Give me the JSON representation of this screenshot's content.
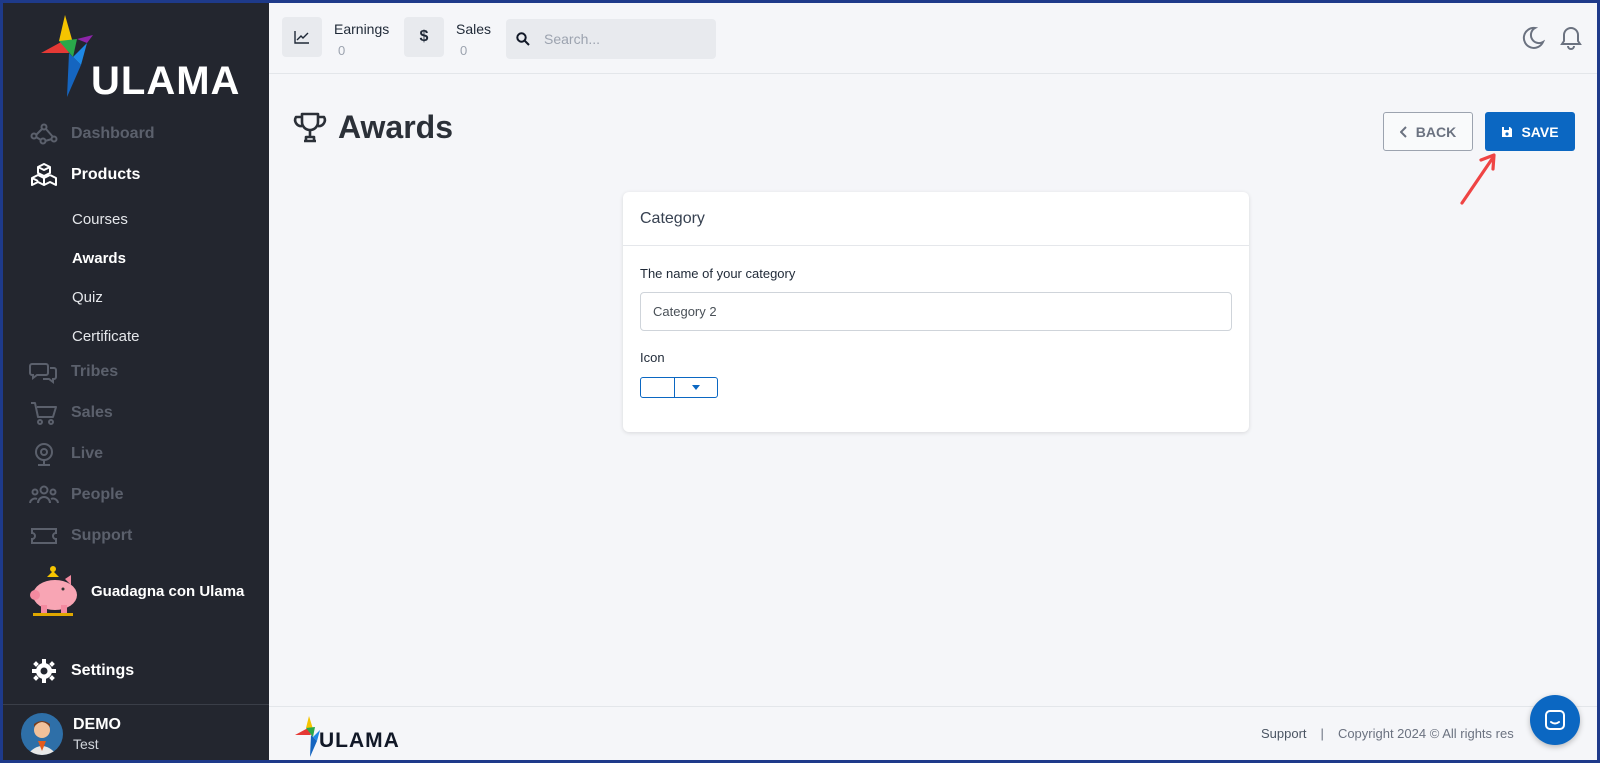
{
  "brand": {
    "name": "ULAMA"
  },
  "sidebar": {
    "items": {
      "dashboard": "Dashboard",
      "products": "Products",
      "tribes": "Tribes",
      "sales": "Sales",
      "live": "Live",
      "people": "People",
      "support": "Support",
      "settings": "Settings"
    },
    "product_sub": [
      "Courses",
      "Awards",
      "Quiz",
      "Certificate"
    ],
    "promo_label": "Guadagna con Ulama",
    "user": {
      "name": "DEMO",
      "role": "Test"
    }
  },
  "topbar": {
    "earnings": {
      "title": "Earnings",
      "value": "0"
    },
    "sales": {
      "title": "Sales",
      "value": "0"
    },
    "search_placeholder": "Search..."
  },
  "page": {
    "title": "Awards",
    "back_label": "BACK",
    "save_label": "SAVE"
  },
  "form": {
    "card_title": "Category",
    "name_label": "The name of your category",
    "name_value": "Category 2",
    "icon_label": "Icon"
  },
  "footer": {
    "support": "Support",
    "separator": "|",
    "copyright": "Copyright 2024 © All rights res"
  },
  "colors": {
    "sidebar_bg": "#23262f",
    "accent": "#0b67c2",
    "annotation_arrow": "#ef4444"
  }
}
